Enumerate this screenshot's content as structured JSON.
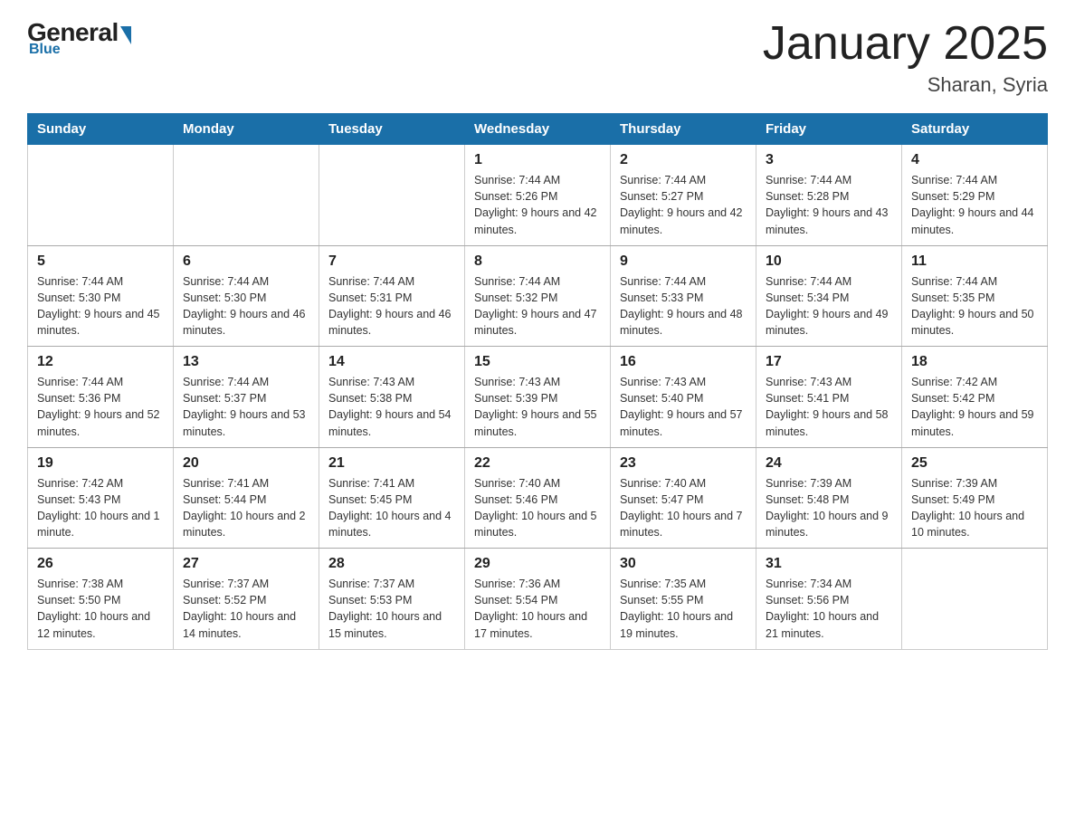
{
  "logo": {
    "general": "General",
    "blue": "Blue",
    "tagline": "Blue"
  },
  "title": "January 2025",
  "subtitle": "Sharan, Syria",
  "weekdays": [
    "Sunday",
    "Monday",
    "Tuesday",
    "Wednesday",
    "Thursday",
    "Friday",
    "Saturday"
  ],
  "weeks": [
    [
      null,
      null,
      null,
      {
        "day": "1",
        "sunrise": "7:44 AM",
        "sunset": "5:26 PM",
        "daylight": "9 hours and 42 minutes."
      },
      {
        "day": "2",
        "sunrise": "7:44 AM",
        "sunset": "5:27 PM",
        "daylight": "9 hours and 42 minutes."
      },
      {
        "day": "3",
        "sunrise": "7:44 AM",
        "sunset": "5:28 PM",
        "daylight": "9 hours and 43 minutes."
      },
      {
        "day": "4",
        "sunrise": "7:44 AM",
        "sunset": "5:29 PM",
        "daylight": "9 hours and 44 minutes."
      }
    ],
    [
      {
        "day": "5",
        "sunrise": "7:44 AM",
        "sunset": "5:30 PM",
        "daylight": "9 hours and 45 minutes."
      },
      {
        "day": "6",
        "sunrise": "7:44 AM",
        "sunset": "5:30 PM",
        "daylight": "9 hours and 46 minutes."
      },
      {
        "day": "7",
        "sunrise": "7:44 AM",
        "sunset": "5:31 PM",
        "daylight": "9 hours and 46 minutes."
      },
      {
        "day": "8",
        "sunrise": "7:44 AM",
        "sunset": "5:32 PM",
        "daylight": "9 hours and 47 minutes."
      },
      {
        "day": "9",
        "sunrise": "7:44 AM",
        "sunset": "5:33 PM",
        "daylight": "9 hours and 48 minutes."
      },
      {
        "day": "10",
        "sunrise": "7:44 AM",
        "sunset": "5:34 PM",
        "daylight": "9 hours and 49 minutes."
      },
      {
        "day": "11",
        "sunrise": "7:44 AM",
        "sunset": "5:35 PM",
        "daylight": "9 hours and 50 minutes."
      }
    ],
    [
      {
        "day": "12",
        "sunrise": "7:44 AM",
        "sunset": "5:36 PM",
        "daylight": "9 hours and 52 minutes."
      },
      {
        "day": "13",
        "sunrise": "7:44 AM",
        "sunset": "5:37 PM",
        "daylight": "9 hours and 53 minutes."
      },
      {
        "day": "14",
        "sunrise": "7:43 AM",
        "sunset": "5:38 PM",
        "daylight": "9 hours and 54 minutes."
      },
      {
        "day": "15",
        "sunrise": "7:43 AM",
        "sunset": "5:39 PM",
        "daylight": "9 hours and 55 minutes."
      },
      {
        "day": "16",
        "sunrise": "7:43 AM",
        "sunset": "5:40 PM",
        "daylight": "9 hours and 57 minutes."
      },
      {
        "day": "17",
        "sunrise": "7:43 AM",
        "sunset": "5:41 PM",
        "daylight": "9 hours and 58 minutes."
      },
      {
        "day": "18",
        "sunrise": "7:42 AM",
        "sunset": "5:42 PM",
        "daylight": "9 hours and 59 minutes."
      }
    ],
    [
      {
        "day": "19",
        "sunrise": "7:42 AM",
        "sunset": "5:43 PM",
        "daylight": "10 hours and 1 minute."
      },
      {
        "day": "20",
        "sunrise": "7:41 AM",
        "sunset": "5:44 PM",
        "daylight": "10 hours and 2 minutes."
      },
      {
        "day": "21",
        "sunrise": "7:41 AM",
        "sunset": "5:45 PM",
        "daylight": "10 hours and 4 minutes."
      },
      {
        "day": "22",
        "sunrise": "7:40 AM",
        "sunset": "5:46 PM",
        "daylight": "10 hours and 5 minutes."
      },
      {
        "day": "23",
        "sunrise": "7:40 AM",
        "sunset": "5:47 PM",
        "daylight": "10 hours and 7 minutes."
      },
      {
        "day": "24",
        "sunrise": "7:39 AM",
        "sunset": "5:48 PM",
        "daylight": "10 hours and 9 minutes."
      },
      {
        "day": "25",
        "sunrise": "7:39 AM",
        "sunset": "5:49 PM",
        "daylight": "10 hours and 10 minutes."
      }
    ],
    [
      {
        "day": "26",
        "sunrise": "7:38 AM",
        "sunset": "5:50 PM",
        "daylight": "10 hours and 12 minutes."
      },
      {
        "day": "27",
        "sunrise": "7:37 AM",
        "sunset": "5:52 PM",
        "daylight": "10 hours and 14 minutes."
      },
      {
        "day": "28",
        "sunrise": "7:37 AM",
        "sunset": "5:53 PM",
        "daylight": "10 hours and 15 minutes."
      },
      {
        "day": "29",
        "sunrise": "7:36 AM",
        "sunset": "5:54 PM",
        "daylight": "10 hours and 17 minutes."
      },
      {
        "day": "30",
        "sunrise": "7:35 AM",
        "sunset": "5:55 PM",
        "daylight": "10 hours and 19 minutes."
      },
      {
        "day": "31",
        "sunrise": "7:34 AM",
        "sunset": "5:56 PM",
        "daylight": "10 hours and 21 minutes."
      },
      null
    ]
  ],
  "labels": {
    "sunrise": "Sunrise:",
    "sunset": "Sunset:",
    "daylight": "Daylight:"
  }
}
